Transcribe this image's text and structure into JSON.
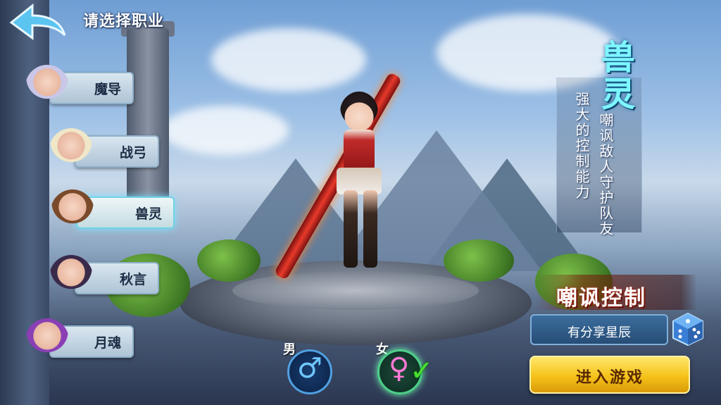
{
  "header": {
    "title": "请选择职业"
  },
  "classes": [
    {
      "label": "魔导",
      "selected": false,
      "hair": "#c9c6e8"
    },
    {
      "label": "战弓",
      "selected": false,
      "hair": "#f0e7c8"
    },
    {
      "label": "兽灵",
      "selected": true,
      "hair": "#7a4a2a"
    },
    {
      "label": "秋言",
      "selected": false,
      "hair": "#3a2a4a"
    },
    {
      "label": "月魂",
      "selected": false,
      "hair": "#8a3fb5"
    }
  ],
  "detail": {
    "class_name": "兽灵",
    "description_1": "强大的控制能力",
    "description_2": "嘲讽敌人守护队友",
    "skill_tag": "嘲讽控制"
  },
  "character_name": "有分享星辰",
  "enter_button": "进入游戏",
  "gender": {
    "male_label": "男",
    "male_symbol": "♂",
    "female_label": "女",
    "female_symbol": "♀",
    "selected": "female"
  },
  "colors": {
    "accent_cyan": "#7ef6ff",
    "button_gold": "#f5c21a",
    "check_green": "#47e02e"
  }
}
